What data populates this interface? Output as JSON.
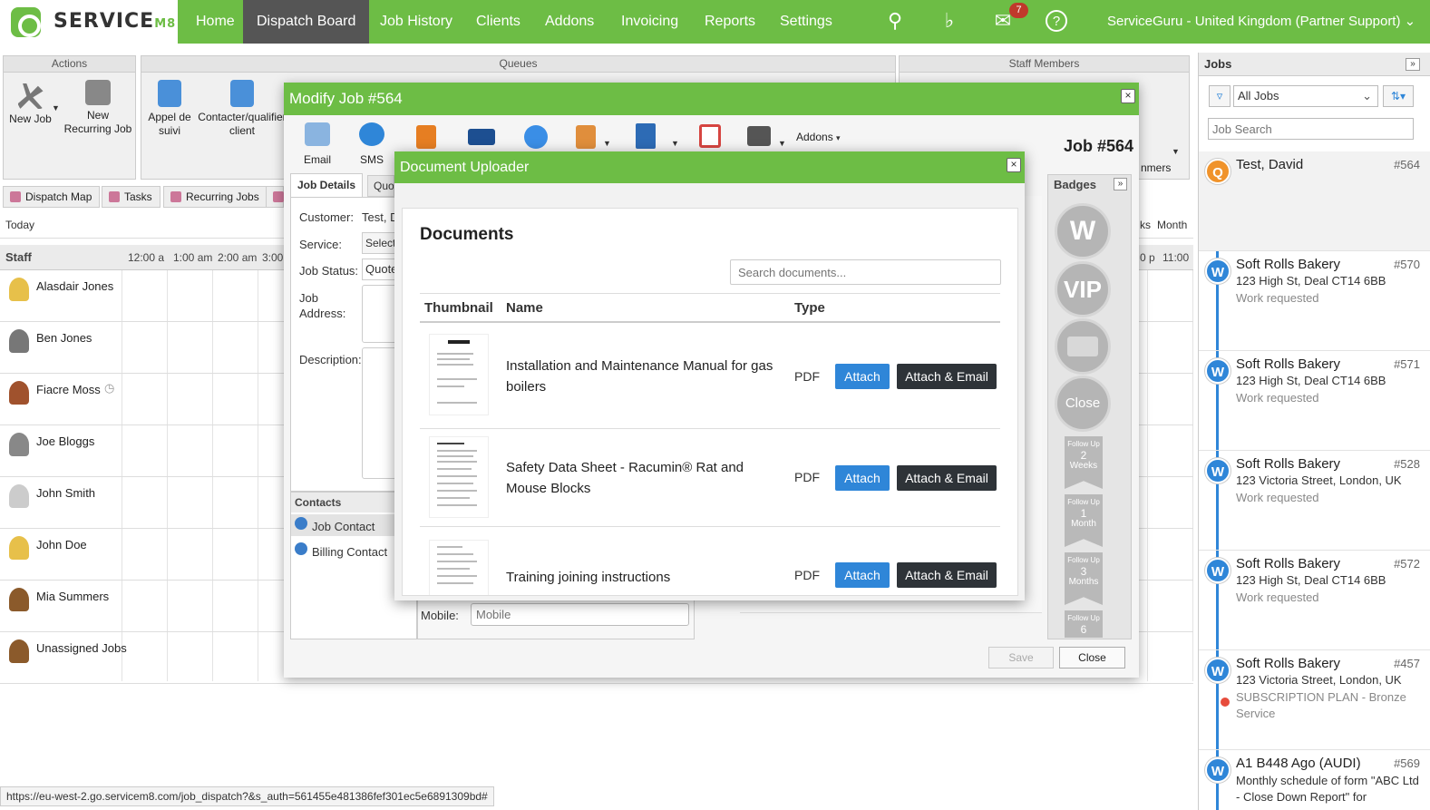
{
  "brand": {
    "name": "SERVICE",
    "suffix": "M8"
  },
  "nav": {
    "items": [
      "Home",
      "Dispatch Board",
      "Job History",
      "Clients",
      "Addons",
      "Invoicing",
      "Reports",
      "Settings"
    ],
    "active": "Dispatch Board",
    "inbox_count": "7",
    "org": "ServiceGuru - United Kingdom (Partner Support)",
    "icons": [
      "search-icon",
      "bell-icon",
      "inbox-icon",
      "help-icon"
    ]
  },
  "toolbar": {
    "actions_title": "Actions",
    "queues_title": "Queues",
    "staff_title": "Staff Members",
    "new_job": "New Job",
    "new_recurring_job": "New Recurring Job",
    "appel_de_suivi": "Appel de suivi",
    "contacter_client": "Contacter/qualifier client",
    "staff_partial": "nmers"
  },
  "left_tabs": [
    "Dispatch Map",
    "Tasks",
    "Recurring Jobs"
  ],
  "schedule": {
    "today": "Today",
    "staff_header": "Staff",
    "hours": [
      "12:00 a",
      "1:00 am",
      "2:00 am",
      "3:00"
    ],
    "right_hour_a": "0 p",
    "right_hour_b": "11:00",
    "view_ks": "ks",
    "view_month": "Month",
    "staff": [
      "Alasdair Jones",
      "Ben Jones",
      "Fiacre Moss",
      "Joe Bloggs",
      "John Smith",
      "John Doe",
      "Mia Summers",
      "Unassigned Jobs"
    ]
  },
  "jobs_panel": {
    "title": "Jobs",
    "filter_value": "All Jobs",
    "search_placeholder": "Job Search",
    "jobs": [
      {
        "letter": "Q",
        "color": "#f0932b",
        "title": "Test, David",
        "number": "#564",
        "address": "",
        "status": ""
      },
      {
        "letter": "W",
        "color": "#2f86d8",
        "title": "Soft Rolls Bakery",
        "number": "#570",
        "address": "123 High St, Deal CT14 6BB",
        "status": "Work requested"
      },
      {
        "letter": "W",
        "color": "#2f86d8",
        "title": "Soft Rolls Bakery",
        "number": "#571",
        "address": "123 High St, Deal CT14 6BB",
        "status": "Work requested"
      },
      {
        "letter": "W",
        "color": "#2f86d8",
        "title": "Soft Rolls Bakery",
        "number": "#528",
        "address": "123 Victoria Street, London, UK",
        "status": "Work requested"
      },
      {
        "letter": "W",
        "color": "#2f86d8",
        "title": "Soft Rolls Bakery",
        "number": "#572",
        "address": "123 High St, Deal CT14 6BB",
        "status": "Work requested"
      },
      {
        "letter": "W",
        "color": "#2f86d8",
        "title": "Soft Rolls Bakery",
        "number": "#457",
        "address": "123 Victoria Street, London, UK",
        "status": "SUBSCRIPTION PLAN - Bronze Service"
      },
      {
        "letter": "W",
        "color": "#2f86d8",
        "title": "A1 B448 Ago (AUDI)",
        "number": "#569",
        "address": "Monthly schedule of form \"ABC Ltd - Close Down Report\" for",
        "status": ""
      }
    ]
  },
  "modify_job": {
    "title": "Modify Job #564",
    "job_number": "Job #564",
    "menu": [
      "Email",
      "SMS"
    ],
    "addons_label": "Addons",
    "tab_details": "Job Details",
    "tab_quote": "Quo",
    "fields": {
      "customer_label": "Customer:",
      "customer_value": "Test, D",
      "service_label": "Service:",
      "service_value": "Select",
      "status_label": "Job Status:",
      "status_value": "Quote",
      "address_label": "Job Address:",
      "description_label": "Description:"
    },
    "contacts_title": "Contacts",
    "contacts": [
      "Job Contact",
      "Billing Contact"
    ],
    "mobile_label": "Mobile:",
    "mobile_placeholder": "Mobile",
    "save_label": "Save",
    "close_label": "Close"
  },
  "badges": {
    "title": "Badges",
    "circles": [
      "W",
      "VIP",
      "",
      "Close"
    ],
    "ribbons": [
      {
        "top": "Follow Up",
        "num": "2",
        "unit": "Weeks"
      },
      {
        "top": "Follow Up",
        "num": "1",
        "unit": "Month"
      },
      {
        "top": "Follow Up",
        "num": "3",
        "unit": "Months"
      },
      {
        "top": "Follow Up",
        "num": "6",
        "unit": ""
      }
    ]
  },
  "doc_uploader": {
    "title": "Document Uploader",
    "heading": "Documents",
    "search_placeholder": "Search documents...",
    "columns": [
      "Thumbnail",
      "Name",
      "Type"
    ],
    "attach_label": "Attach",
    "attach_email_label": "Attach & Email",
    "docs": [
      {
        "name": "Installation and Maintenance Manual for gas boilers",
        "type": "PDF"
      },
      {
        "name": "Safety Data Sheet - Racumin® Rat and Mouse Blocks",
        "type": "PDF"
      },
      {
        "name": "Training joining instructions",
        "type": "PDF"
      }
    ]
  },
  "status_url": "https://eu-west-2.go.servicem8.com/job_dispatch?&s_auth=561455e481386fef301ec5e6891309bd#"
}
